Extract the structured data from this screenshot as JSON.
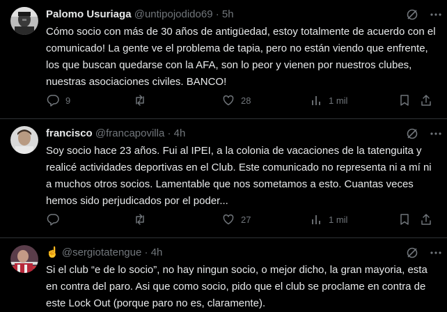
{
  "tweets": [
    {
      "name": "Palomo Usuriaga",
      "handle": "@untipojodido69",
      "sep": "·",
      "time": "5h",
      "text": "Cómo socio con más de 30 años de antigüedad, estoy totalmente de acuerdo con el comunicado! La gente ve el problema de tapia, pero no están viendo que enfrente, los que buscan quedarse con la AFA, son lo peor y vienen por nuestros clubes, nuestras asociaciones civiles. BANCO!",
      "replies": "9",
      "retweets": "",
      "likes": "28",
      "views": "1 mil"
    },
    {
      "name": "francisco",
      "handle": "@francapovilla",
      "sep": "·",
      "time": "4h",
      "text": "Soy socio hace 23 años. Fui al IPEI, a la colonia de vacaciones de la tatenguita y realicé actividades deportivas en el Club. Este comunicado no representa ni a mí ni a muchos otros socios. Lamentable que nos sometamos a esto. Cuantas veces hemos sido perjudicados por el poder...",
      "replies": "",
      "retweets": "",
      "likes": "27",
      "views": "1 mil"
    },
    {
      "name": "☝️",
      "handle": "@sergiotatengue",
      "sep": "·",
      "time": "4h",
      "text": "Si el club “e de lo socio”, no hay ningun socio, o mejor dicho, la gran mayoria, esta en contra del paro. Asi que como socio, pido que el club se proclame en contra de este Lock Out (porque paro no es, claramente)."
    }
  ],
  "icons": {
    "grok": "grok-icon",
    "more": "more-icon",
    "reply": "reply-icon",
    "retweet": "retweet-icon",
    "like": "like-icon",
    "views": "views-icon",
    "bookmark": "bookmark-icon",
    "share": "share-icon"
  },
  "colors": {
    "background": "#000000",
    "text": "#e7e9ea",
    "secondary": "#71767b",
    "divider": "#2f3336"
  }
}
